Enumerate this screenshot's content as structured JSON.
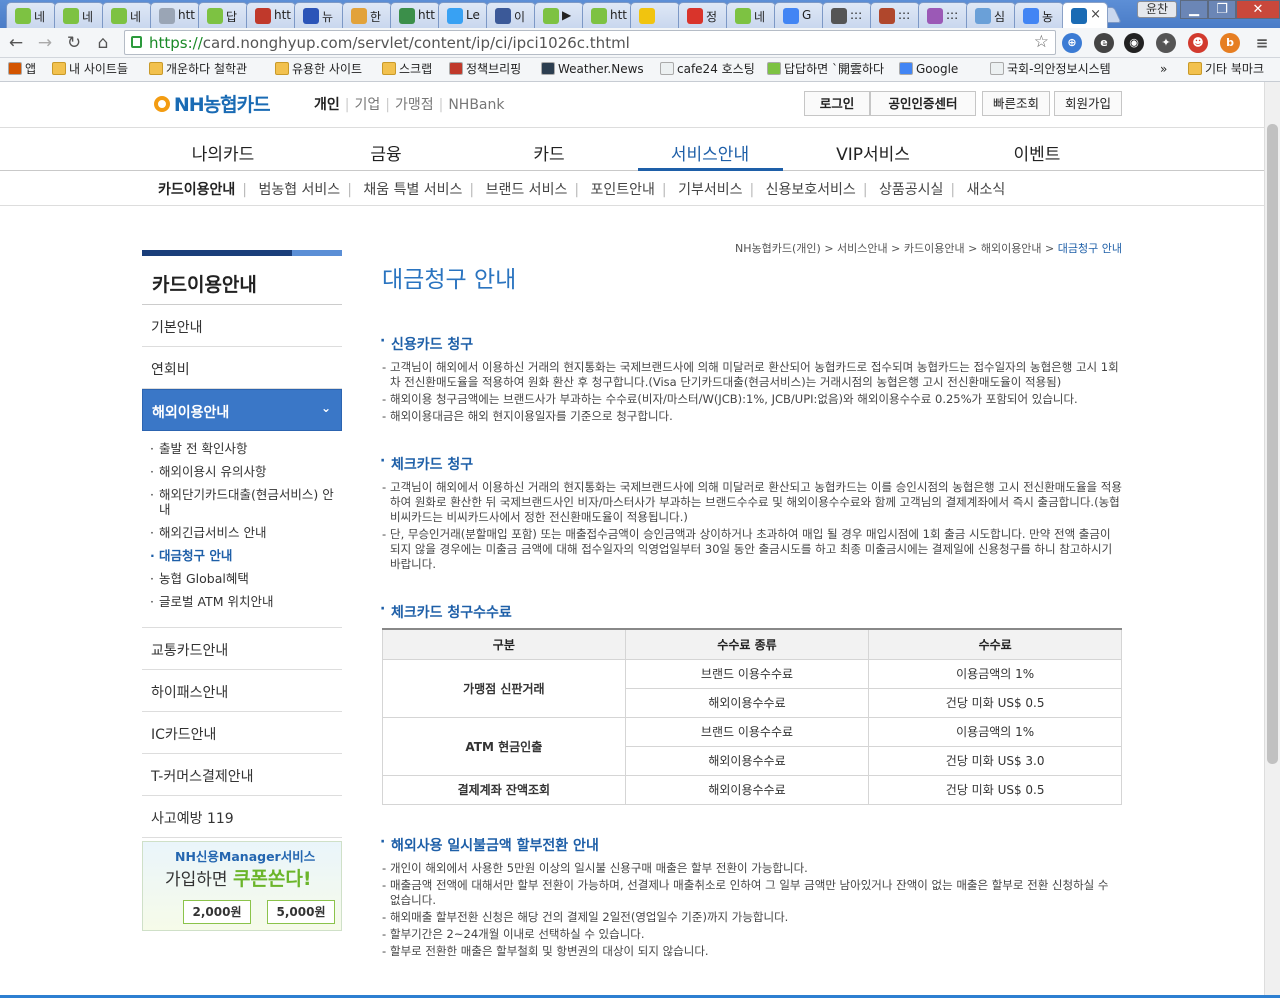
{
  "browser": {
    "tabs": [
      {
        "label": "네",
        "fav": "naver-leaf-icon",
        "color": "#7dc242"
      },
      {
        "label": "네",
        "fav": "naver-leaf-icon",
        "color": "#7dc242"
      },
      {
        "label": "네",
        "fav": "naver-leaf-icon",
        "color": "#7dc242"
      },
      {
        "label": "htt",
        "fav": "page-icon",
        "color": "#9aa5b5"
      },
      {
        "label": "답",
        "fav": "naver-leaf-icon",
        "color": "#7dc242"
      },
      {
        "label": "htt",
        "fav": "red-cube-icon",
        "color": "#c0392b"
      },
      {
        "label": "뉴",
        "fav": "z-icon",
        "color": "#2b54b8"
      },
      {
        "label": "한",
        "fav": "plus-icon",
        "color": "#e2a23a"
      },
      {
        "label": "htt",
        "fav": "person-icon",
        "color": "#3b8f4a"
      },
      {
        "label": "Le",
        "fav": "twitter-icon",
        "color": "#38a1f3"
      },
      {
        "label": "이",
        "fav": "facebook-icon",
        "color": "#3b5998"
      },
      {
        "label": "▶",
        "fav": "naver-leaf-icon",
        "color": "#7dc242"
      },
      {
        "label": "htt",
        "fav": "naver-leaf-icon",
        "color": "#7dc242"
      },
      {
        "label": "",
        "fav": "yellow-icon",
        "color": "#f1c40f"
      },
      {
        "label": "정",
        "fav": "red-icon",
        "color": "#d9342b"
      },
      {
        "label": "네",
        "fav": "naver-leaf-icon",
        "color": "#7dc242"
      },
      {
        "label": "G",
        "fav": "google-icon",
        "color": "#4285f4"
      },
      {
        "label": ":::",
        "fav": "soccer-icon",
        "color": "#555555"
      },
      {
        "label": ":::",
        "fav": "circle-icon",
        "color": "#b0472c"
      },
      {
        "label": ":::",
        "fav": "flower-icon",
        "color": "#9b59b6"
      },
      {
        "label": "심",
        "fav": "globe-icon",
        "color": "#6aa0d8"
      },
      {
        "label": "농",
        "fav": "google-icon",
        "color": "#4285f4"
      },
      {
        "label": "",
        "fav": "nh-icon",
        "color": "#1a6bb4"
      }
    ],
    "user_badge": "윤찬",
    "window_buttons": {
      "min": "▁",
      "max": "❐",
      "close": "✕"
    },
    "url_scheme": "https://",
    "url_rest": "card.nonghyup.com/servlet/content/ip/ci/ipci1026c.thtml",
    "bookmarks": [
      {
        "label": "앱",
        "icon": "apps-icon"
      },
      {
        "label": "내 사이트들",
        "icon": "folder-icon"
      },
      {
        "label": "개운하다 철학관",
        "icon": "folder-icon"
      },
      {
        "label": "유용한 사이트",
        "icon": "folder-icon"
      },
      {
        "label": "스크랩",
        "icon": "folder-icon"
      },
      {
        "label": "정책브리핑",
        "icon": "briefing-icon"
      },
      {
        "label": "Weather.News",
        "icon": "weather-icon"
      },
      {
        "label": "cafe24 호스팅",
        "icon": "page-icon"
      },
      {
        "label": "답답하면 `開雲하다",
        "icon": "leaf-icon"
      },
      {
        "label": "Google",
        "icon": "google-icon"
      },
      {
        "label": "국회-의안정보시스템",
        "icon": "page-icon"
      },
      {
        "label": "»",
        "icon": ""
      },
      {
        "label": "기타 북마크",
        "icon": "folder-icon"
      }
    ]
  },
  "site": {
    "logo": "NH농협카드",
    "biz_tabs": [
      "개인",
      "기업",
      "가맹점",
      "NHBank"
    ],
    "header_buttons": [
      "로그인",
      "공인인증센터",
      "빠른조회",
      "회원가입"
    ],
    "gnb": [
      "나의카드",
      "금융",
      "카드",
      "서비스안내",
      "VIP서비스",
      "이벤트"
    ],
    "sub_gnb": [
      "카드이용안내",
      "범농협 서비스",
      "채움 특별 서비스",
      "브랜드 서비스",
      "포인트안내",
      "기부서비스",
      "신용보호서비스",
      "상품공시실",
      "새소식"
    ]
  },
  "lnb": {
    "title": "카드이용안내",
    "items_before": [
      "기본안내",
      "연회비"
    ],
    "active": "해외이용안내",
    "sub_items": [
      "출발 전 확인사항",
      "해외이용시 유의사항",
      "해외단기카드대출(현금서비스) 안내",
      "해외긴급서비스 안내",
      "대금청구 안내",
      "농협 Global혜택",
      "글로벌 ATM 위치안내"
    ],
    "items_after": [
      "교통카드안내",
      "하이패스안내",
      "IC카드안내",
      "T-커머스결제안내",
      "사고예방 119"
    ],
    "promo": {
      "line1": "NH신용Manager서비스",
      "line2_a": "가입하면",
      "line2_b": "쿠폰쏜다!",
      "coupon1": "2,000원",
      "coupon2": "5,000원"
    }
  },
  "content": {
    "breadcrumb": [
      "NH농협카드(개인)",
      "서비스안내",
      "카드이용안내",
      "해외이용안내",
      "대금청구 안내"
    ],
    "title": "대금청구 안내",
    "sections": [
      {
        "title": "신용카드 청구",
        "items": [
          "고객님이 해외에서 이용하신 거래의 현지통화는 국제브랜드사에 의해 미달러로 환산되어 농협카드로 접수되며 농협카드는 접수일자의 농협은행 고시 1회차 전신환매도율을 적용하여 원화 환산 후 청구합니다.(Visa 단기카드대출(현금서비스)는 거래시점의 농협은행 고시 전신환매도율이 적용됨)",
          "해외이용 청구금액에는 브랜드사가 부과하는 수수료(비자/마스터/W(JCB):1%, JCB/UPI:없음)와 해외이용수수료 0.25%가 포함되어 있습니다.",
          "해외이용대금은 해외 현지이용일자를 기준으로 청구합니다."
        ]
      },
      {
        "title": "체크카드 청구",
        "items": [
          "고객님이 해외에서 이용하신 거래의 현지통화는 국제브랜드사에 의해 미달러로 환산되고 농협카드는 이를 승인시점의 농협은행 고시 전신환매도율을 적용하여 원화로 환산한 뒤 국제브랜드사인 비자/마스터사가 부과하는 브랜드수수료 및 해외이용수수료와 함께 고객님의 결제계좌에서 즉시 출금합니다.(농협비씨카드는 비씨카드사에서 정한 전신환매도율이 적용됩니다.)",
          "단, 무승인거래(분할매입 포함) 또는 매출접수금액이 승인금액과 상이하거나 초과하여 매입 될 경우 매입시점에 1회 출금 시도합니다. 만약 전액 출금이 되지 않을 경우에는 미출금 금액에 대해 접수일자의 익영업일부터 30일 동안 출금시도를 하고 최종 미출금시에는 결제일에 신용청구를 하니 참고하시기 바랍니다."
        ]
      }
    ],
    "fee_section_title": "체크카드 청구수수료",
    "fee_table": {
      "headers": [
        "구분",
        "수수료 종류",
        "수수료"
      ],
      "groups": [
        {
          "category": "가맹점 신판거래",
          "rows": [
            [
              "브랜드 이용수수료",
              "이용금액의 1%"
            ],
            [
              "해외이용수수료",
              "건당 미화 US$ 0.5"
            ]
          ]
        },
        {
          "category": "ATM 현금인출",
          "rows": [
            [
              "브랜드 이용수수료",
              "이용금액의 1%"
            ],
            [
              "해외이용수수료",
              "건당 미화 US$ 3.0"
            ]
          ]
        },
        {
          "category": "결제계좌 잔액조회",
          "rows": [
            [
              "해외이용수수료",
              "건당 미화 US$ 0.5"
            ]
          ]
        }
      ]
    },
    "installment_section": {
      "title": "해외사용 일시불금액 할부전환 안내",
      "items": [
        "개인이 해외에서 사용한 5만원 이상의 일시불 신용구매 매출은 할부 전환이 가능합니다.",
        "매출금액 전액에 대해서만 할부 전환이 가능하며, 선결제나 매출취소로 인하여 그 일부 금액만 남아있거나 잔액이 없는 매출은 할부로 전환 신청하실 수 없습니다.",
        "해외매출 할부전환 신청은 해당 건의 결제일 2일전(영업일수 기준)까지 가능합니다.",
        "할부기간은 2~24개월 이내로 선택하실 수 있습니다.",
        "할부로 전환한 매출은 할부철회 및 항변권의 대상이 되지 않습니다."
      ]
    }
  }
}
